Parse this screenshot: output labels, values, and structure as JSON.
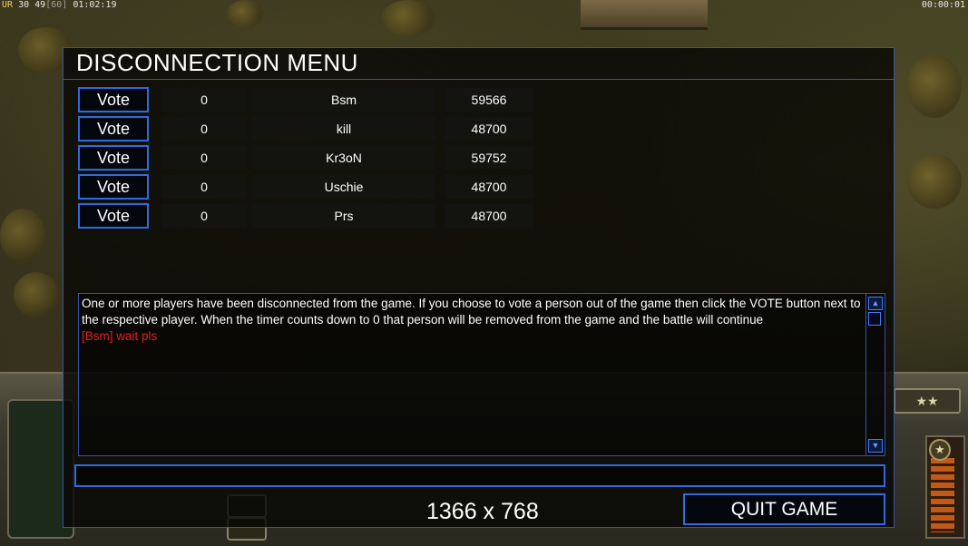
{
  "hud": {
    "stats_ur": "UR",
    "stats_values": "30 49",
    "stats_fps": "[60]",
    "stats_time": "01:02:19",
    "timer": "00:00:01"
  },
  "menu": {
    "title": "DISCONNECTION MENU",
    "vote_label": "Vote",
    "players": [
      {
        "votes": "0",
        "name": "Bsm",
        "ping": "59566"
      },
      {
        "votes": "0",
        "name": "kill",
        "ping": "48700"
      },
      {
        "votes": "0",
        "name": "Kr3oN",
        "ping": "59752"
      },
      {
        "votes": "0",
        "name": "Uschie",
        "ping": "48700"
      },
      {
        "votes": "0",
        "name": "Prs",
        "ping": "48700"
      }
    ],
    "message": "One or more players have been disconnected from the game. If you choose to vote a person out of the game then click the VOTE button next to the respective player. When the timer counts down to 0 that person will be removed from the game and the battle will continue",
    "chat_line": "[Bsm] wait pls",
    "chat_input_value": "",
    "quit_label": "QUIT GAME"
  },
  "overlay": {
    "resolution": "1366 x 768"
  },
  "colors": {
    "border_blue": "#2f6be0",
    "chat_red": "#e02020"
  }
}
